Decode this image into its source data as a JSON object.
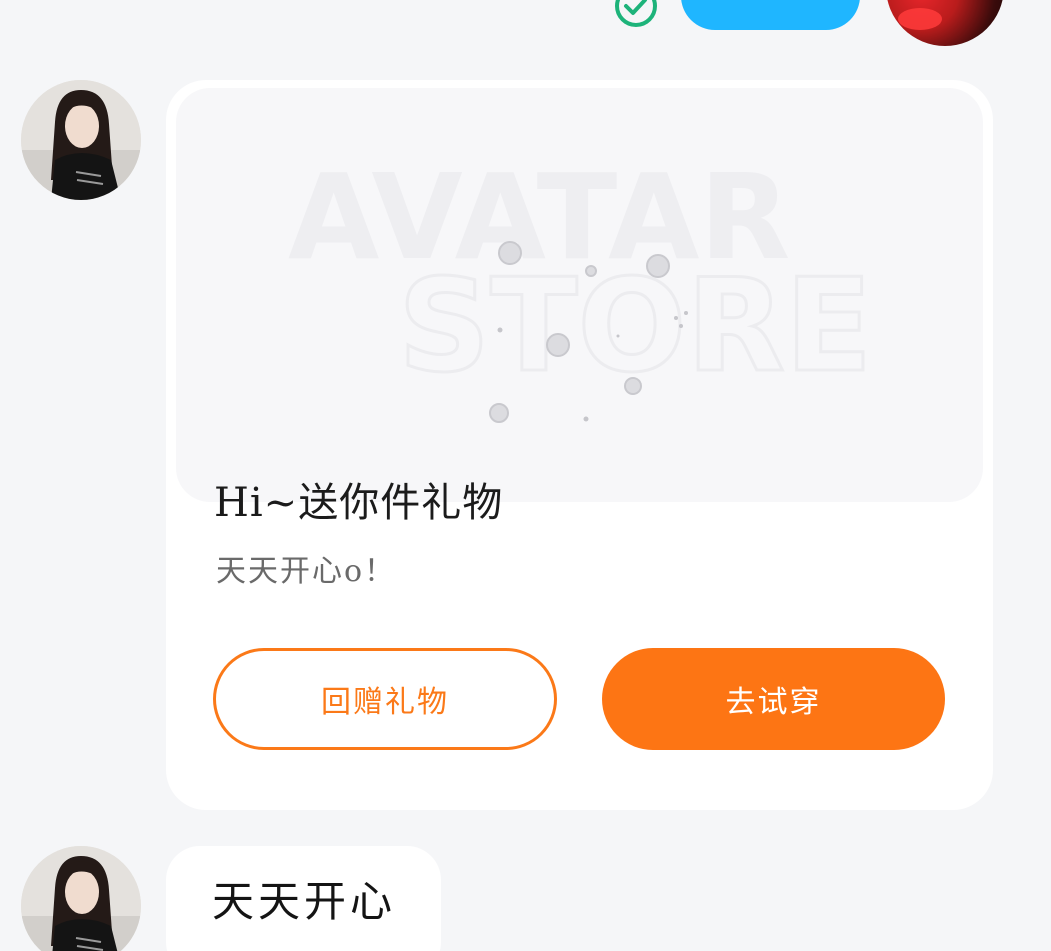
{
  "chat": {
    "gift_card": {
      "banner_title_line1": "AVATAR",
      "banner_title_line2": "STORE",
      "title": "Hi~送你件礼物",
      "subtitle": "天天开心o！",
      "return_gift_label": "回赠礼物",
      "try_on_label": "去试穿"
    },
    "text_message": "天天开心"
  },
  "colors": {
    "accent_orange": "#fd7514",
    "sent_bubble": "#1fb6ff",
    "read_check": "#1db37a",
    "background": "#f5f6f8"
  },
  "icons": {
    "read_status": "check-circle-icon"
  }
}
